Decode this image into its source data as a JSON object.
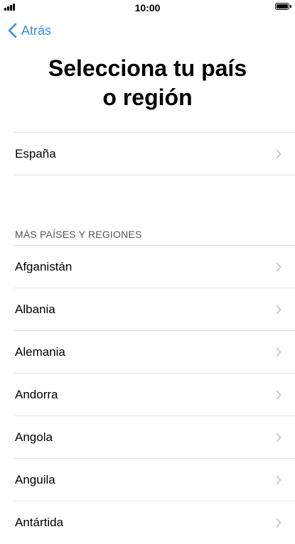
{
  "status_bar": {
    "time": "10:00"
  },
  "nav": {
    "back_label": "Atrás"
  },
  "title": {
    "line1": "Selecciona tu país",
    "line2": "o región"
  },
  "suggested": {
    "items": [
      {
        "label": "España"
      }
    ]
  },
  "more": {
    "header": "MÁS PAÍSES Y REGIONES",
    "items": [
      {
        "label": "Afganistán"
      },
      {
        "label": "Albania"
      },
      {
        "label": "Alemania"
      },
      {
        "label": "Andorra"
      },
      {
        "label": "Angola"
      },
      {
        "label": "Anguila"
      },
      {
        "label": "Antártida"
      }
    ]
  },
  "colors": {
    "accent": "#3b8cd9",
    "separator": "#e3e3e6",
    "chevron": "#c7c7cc"
  },
  "icons": {
    "back": "chevron-left-icon",
    "row": "chevron-right-icon",
    "signal": "cellular-signal-icon",
    "battery": "battery-icon"
  }
}
